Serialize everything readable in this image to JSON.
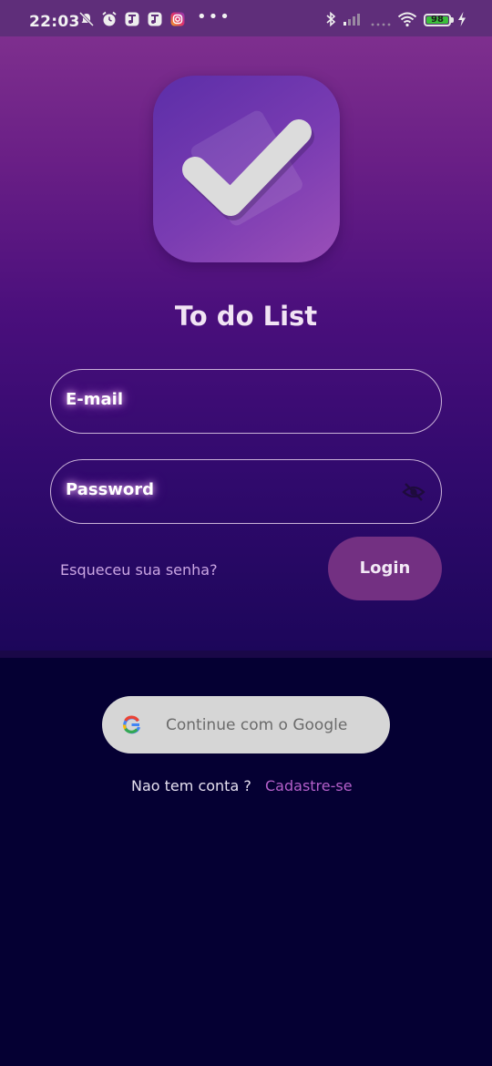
{
  "status_bar": {
    "time": "22:03",
    "battery_level": "98",
    "battery_fraction": 0.98,
    "more_indicator": "•••",
    "icons": [
      "muted-icon",
      "alarm-icon",
      "notification-icon",
      "notification-icon",
      "instagram-icon",
      "bluetooth-icon",
      "signal-icon",
      "wifi-icon",
      "battery-icon",
      "charging-icon"
    ]
  },
  "app": {
    "title": "To do List",
    "logo_icon": "check-icon"
  },
  "form": {
    "email_placeholder": "E-mail",
    "password_placeholder": "Password",
    "visibility_icon": "eye-off-icon",
    "forgot_password": "Esqueceu sua senha?",
    "login_label": "Login"
  },
  "social": {
    "google_label": "Continue com o Google",
    "google_icon": "google-icon"
  },
  "footer": {
    "prompt": "Nao tem conta ?",
    "signup_link": "Cadastre-se"
  },
  "colors": {
    "hero_top": "#7e2f8e",
    "hero_bottom": "#1c065a",
    "background": "#050033",
    "login_button": "#733082",
    "accent_link": "#b45fc9",
    "google_button": "#d6d6d6"
  }
}
